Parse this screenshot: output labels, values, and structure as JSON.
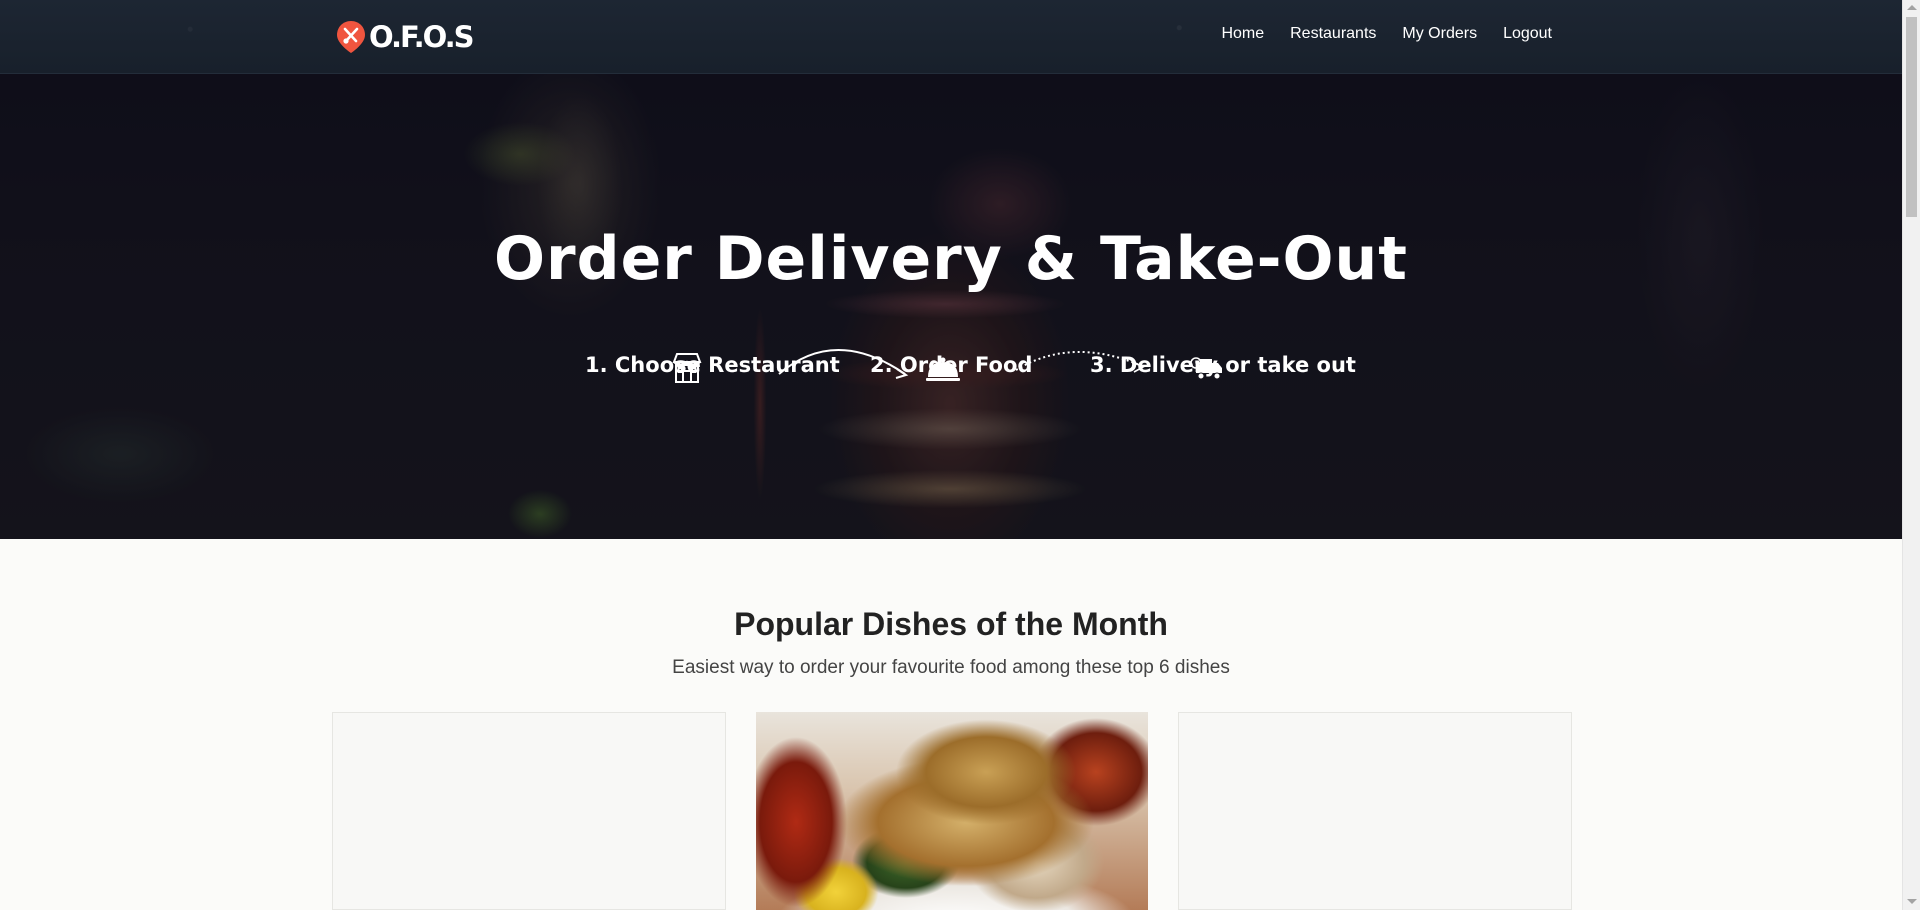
{
  "navbar": {
    "logo_text": "O.F.O.S",
    "links": [
      {
        "label": "Home"
      },
      {
        "label": "Restaurants"
      },
      {
        "label": "My Orders"
      },
      {
        "label": "Logout"
      }
    ]
  },
  "hero": {
    "title": "Order Delivery & Take-Out",
    "steps": [
      {
        "label": "1. Choose Restaurant",
        "icon": "store-icon"
      },
      {
        "label": "2. Order Food",
        "icon": "food-cloche-icon"
      },
      {
        "label": "3. Delivery or take out",
        "icon": "delivery-truck-icon"
      }
    ]
  },
  "popular": {
    "title": "Popular Dishes of the Month",
    "subtitle": "Easiest way to order your favourite food among these top 6 dishes"
  },
  "colors": {
    "brand_accent": "#f0553f",
    "navbar_bg": "#1b2430",
    "page_bg": "#fbfbf9"
  }
}
